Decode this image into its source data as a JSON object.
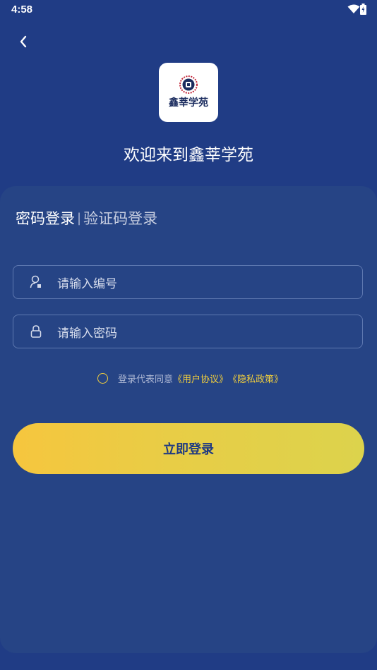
{
  "status_bar": {
    "time": "4:58"
  },
  "header": {
    "logo_text": "鑫莘学苑",
    "welcome": "欢迎来到鑫莘学苑"
  },
  "tabs": {
    "active": "密码登录",
    "divider": "|",
    "inactive": "验证码登录"
  },
  "form": {
    "username_placeholder": "请输入编号",
    "password_placeholder": "请输入密码"
  },
  "agreement": {
    "prefix": "登录代表同意",
    "user_agreement": "《用户协议》",
    "privacy_policy": "《隐私政策》"
  },
  "login_button": "立即登录",
  "colors": {
    "background": "#203c85",
    "card": "#264485",
    "accent": "#f2cf3c",
    "button_text": "#1f3a82"
  }
}
